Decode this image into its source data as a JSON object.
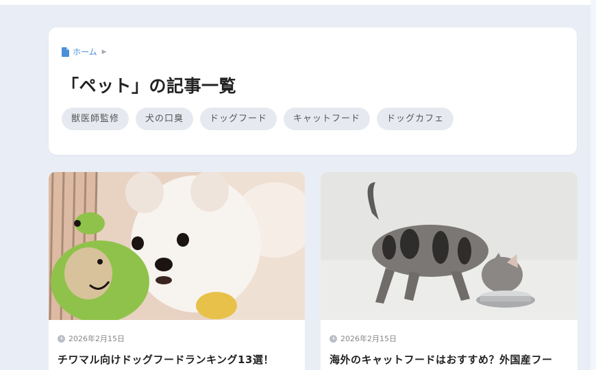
{
  "breadcrumb": {
    "home_label": "ホーム",
    "icon": "document-icon",
    "separator_icon": "chevron-right-icon"
  },
  "page_title": "「ペット」の記事一覧",
  "tags": [
    "獣医師監修",
    "犬の口臭",
    "ドッグフード",
    "キャットフード",
    "ドッグカフェ"
  ],
  "articles": [
    {
      "date": "2026年2月15日",
      "title": "チワマル向けドッグフードランキング13選！",
      "image": "white-puppy-with-green-frog-toy"
    },
    {
      "date": "2026年2月15日",
      "title": "海外のキャットフードはおすすめ？外国産フー",
      "image": "tabby-kitten-eating-from-bowl"
    }
  ],
  "colors": {
    "background": "#e9eef6",
    "card": "#ffffff",
    "link": "#4a90d9",
    "tag_bg": "#e6eaf0"
  }
}
